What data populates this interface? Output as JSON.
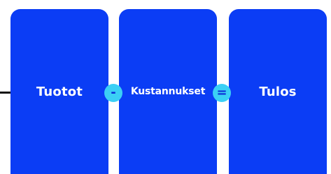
{
  "colors": {
    "card_fill": "#0b3df5",
    "operator_fill": "#3bd0f5",
    "operator_text": "#0b2bd6",
    "line": "#111111"
  },
  "cards": [
    {
      "label": "Tuotot"
    },
    {
      "label": "Kustannukset"
    },
    {
      "label": "Tulos"
    }
  ],
  "operators": [
    {
      "symbol": "-"
    },
    {
      "symbol": "="
    }
  ]
}
